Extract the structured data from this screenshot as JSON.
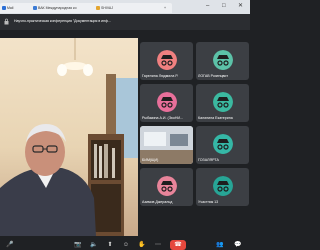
{
  "browser": {
    "tabs": [
      {
        "label": "Mail"
      },
      {
        "label": "ВАК Международная ко"
      },
      {
        "label": "SHIVAJ"
      }
    ],
    "new_tab": "+",
    "controls": {
      "min": "–",
      "max": "□",
      "close": "✕"
    }
  },
  "meeting": {
    "title": "Научно-практическая конференция \"Документация в инф..."
  },
  "participants": [
    {
      "name": "Гарелина Людмила Р.",
      "avatar": "spy",
      "color": "#f08080"
    },
    {
      "name": "ЛОГАВ Розенцвит",
      "avatar": "spy",
      "color": "#5cc2a8"
    },
    {
      "name": "Рыбакина А.И. (ЭкоНИ...",
      "avatar": "spy",
      "color": "#e86f9a"
    },
    {
      "name": "Калинина Екатерина",
      "avatar": "spy",
      "color": "#3bb9a0"
    },
    {
      "name": "БИМ(ЩИ)",
      "avatar": "camera",
      "color": "#6f7a86"
    },
    {
      "name": "ГОЗАЛЯРТА",
      "avatar": "spy",
      "color": "#35b7a6"
    },
    {
      "name": "Азимов Джеральд",
      "avatar": "spy",
      "color": "#e8849a"
    },
    {
      "name": "Участник 13",
      "avatar": "spy",
      "color": "#27a596"
    }
  ],
  "colors": {
    "accent": "#6aa4ff"
  }
}
